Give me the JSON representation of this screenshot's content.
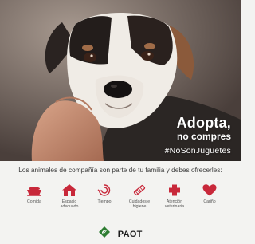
{
  "colors": {
    "accent": "#c8283a",
    "brand_green": "#2e7d32",
    "text_dark": "#3a3a3a"
  },
  "headline": {
    "title": "Adopta,",
    "subtitle": "no compres",
    "hashtag": "#NoSonJuguetes"
  },
  "intro_text": "Los animales de compañía son parte  de tu familia y debes ofrecerles:",
  "needs": [
    {
      "icon": "food-bowl-icon",
      "label": "Comida"
    },
    {
      "icon": "house-icon",
      "label": "Espacio adecuado"
    },
    {
      "icon": "clock-spiral-icon",
      "label": "Tiempo"
    },
    {
      "icon": "brush-icon",
      "label": "Cuidados e higiene"
    },
    {
      "icon": "medical-cross-icon",
      "label": "Atención veterinaria"
    },
    {
      "icon": "heart-icon",
      "label": "Cariño"
    }
  ],
  "brand": {
    "name": "PAOT",
    "logo_icon": "paot-logo-icon"
  }
}
